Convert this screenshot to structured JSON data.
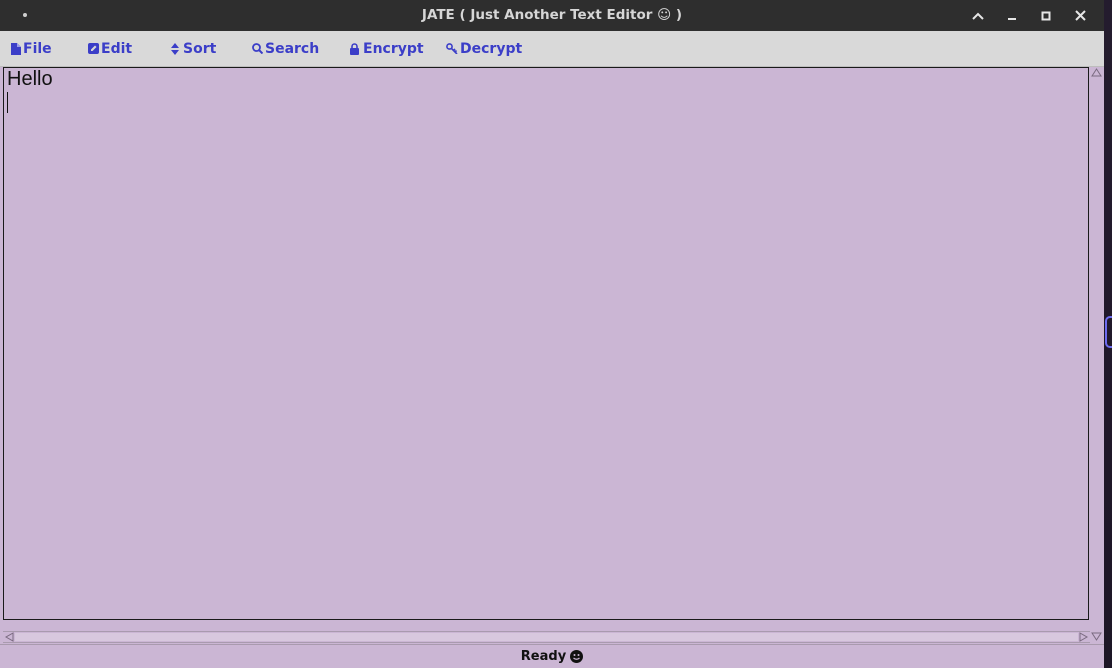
{
  "window": {
    "title": "JATE ( Just Another Text Editor ☺ )",
    "controls": [
      "chevron-up-icon",
      "minimize-icon",
      "maximize-icon",
      "close-icon"
    ]
  },
  "menu": {
    "file": "File",
    "edit": "Edit",
    "sort": "Sort",
    "search": "Search",
    "encrypt": "Encrypt",
    "decrypt": "Decrypt"
  },
  "editor": {
    "text": "Hello"
  },
  "status": {
    "text": "Ready"
  },
  "colors": {
    "accent": "#3b3ec8",
    "editor_bg": "#cbb6d4",
    "titlebar": "#2e2e2e"
  }
}
